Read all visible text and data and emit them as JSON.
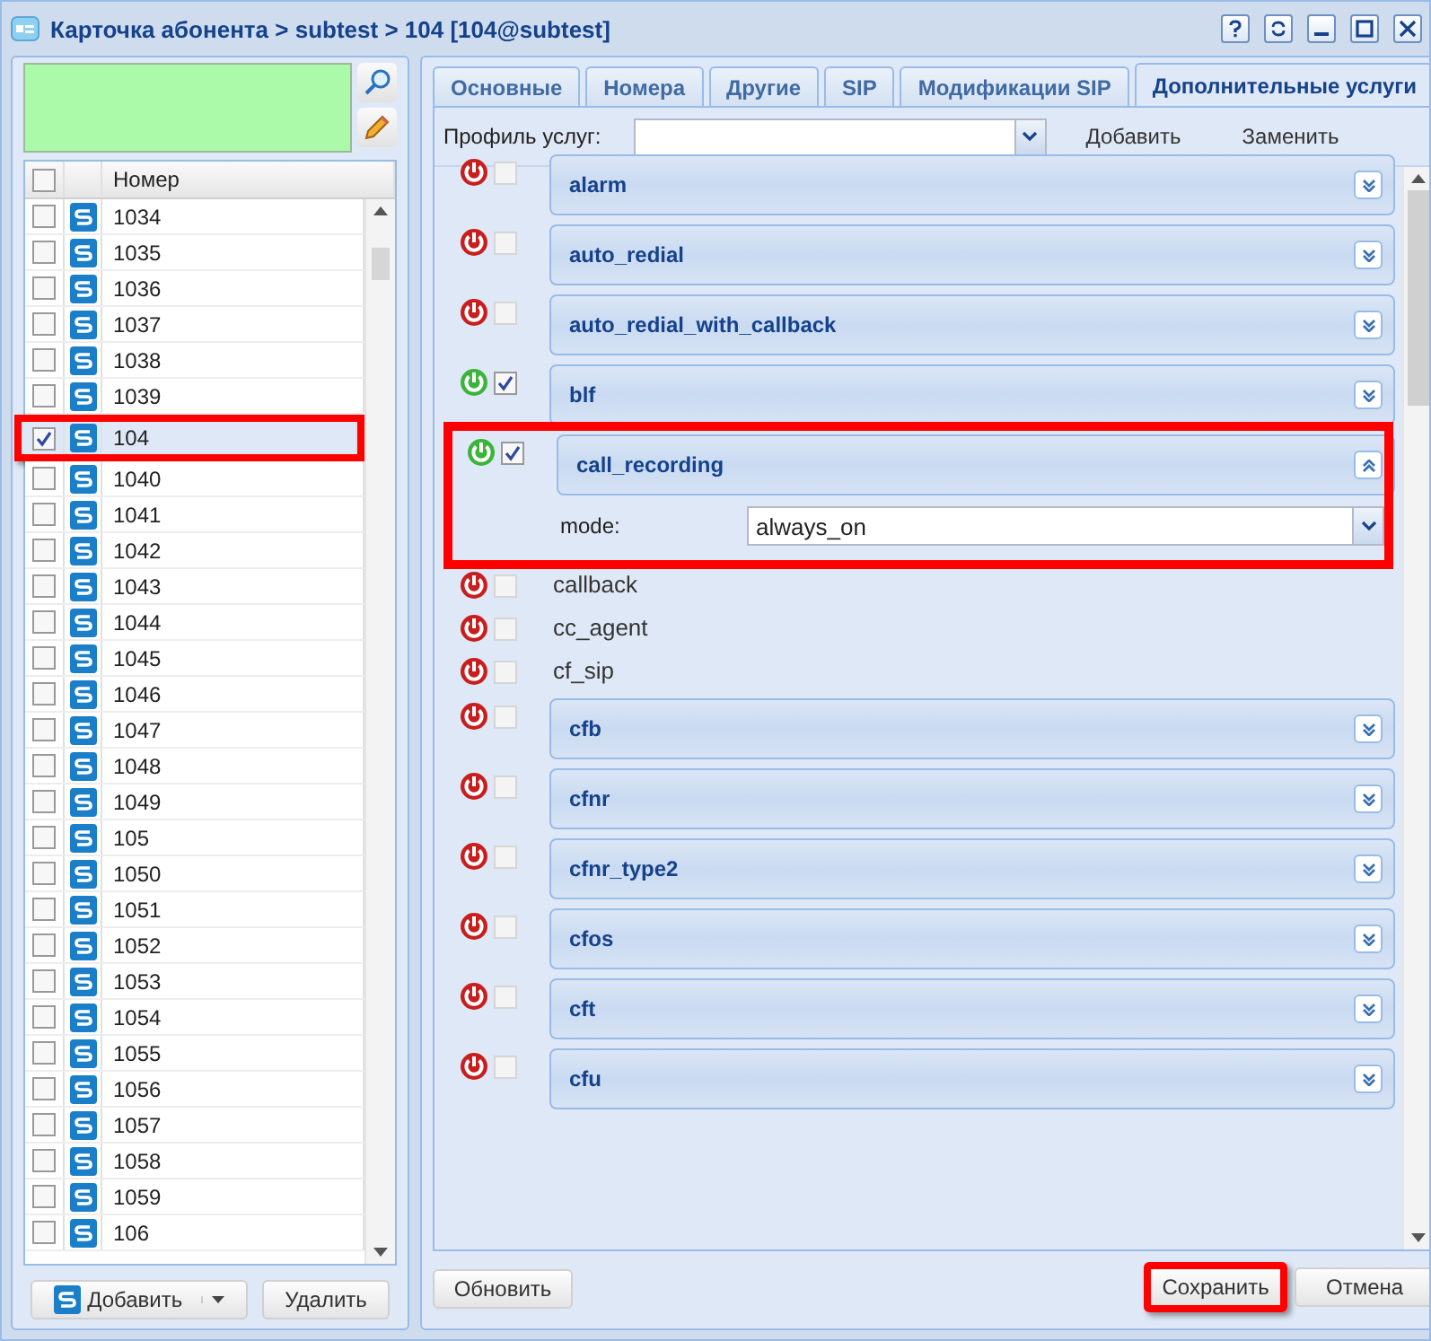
{
  "window": {
    "title": "Карточка абонента > subtest > 104 [104@subtest]"
  },
  "left_panel": {
    "grid": {
      "columns": [
        "Номер"
      ],
      "all_checked": false,
      "rows": [
        {
          "number": "1034",
          "checked": false,
          "highlighted": false
        },
        {
          "number": "1035",
          "checked": false,
          "highlighted": false
        },
        {
          "number": "1036",
          "checked": false,
          "highlighted": false
        },
        {
          "number": "1037",
          "checked": false,
          "highlighted": false
        },
        {
          "number": "1038",
          "checked": false,
          "highlighted": false
        },
        {
          "number": "1039",
          "checked": false,
          "highlighted": false
        },
        {
          "number": "104",
          "checked": true,
          "highlighted": true
        },
        {
          "number": "1040",
          "checked": false,
          "highlighted": false
        },
        {
          "number": "1041",
          "checked": false,
          "highlighted": false
        },
        {
          "number": "1042",
          "checked": false,
          "highlighted": false
        },
        {
          "number": "1043",
          "checked": false,
          "highlighted": false
        },
        {
          "number": "1044",
          "checked": false,
          "highlighted": false
        },
        {
          "number": "1045",
          "checked": false,
          "highlighted": false
        },
        {
          "number": "1046",
          "checked": false,
          "highlighted": false
        },
        {
          "number": "1047",
          "checked": false,
          "highlighted": false
        },
        {
          "number": "1048",
          "checked": false,
          "highlighted": false
        },
        {
          "number": "1049",
          "checked": false,
          "highlighted": false
        },
        {
          "number": "105",
          "checked": false,
          "highlighted": false
        },
        {
          "number": "1050",
          "checked": false,
          "highlighted": false
        },
        {
          "number": "1051",
          "checked": false,
          "highlighted": false
        },
        {
          "number": "1052",
          "checked": false,
          "highlighted": false
        },
        {
          "number": "1053",
          "checked": false,
          "highlighted": false
        },
        {
          "number": "1054",
          "checked": false,
          "highlighted": false
        },
        {
          "number": "1055",
          "checked": false,
          "highlighted": false
        },
        {
          "number": "1056",
          "checked": false,
          "highlighted": false
        },
        {
          "number": "1057",
          "checked": false,
          "highlighted": false
        },
        {
          "number": "1058",
          "checked": false,
          "highlighted": false
        },
        {
          "number": "1059",
          "checked": false,
          "highlighted": false
        },
        {
          "number": "106",
          "checked": false,
          "highlighted": false
        }
      ]
    },
    "buttons": [
      "Добавить",
      "Удалить"
    ]
  },
  "tabs": [
    {
      "label": "Основные",
      "selected": false
    },
    {
      "label": "Номера",
      "selected": false
    },
    {
      "label": "Другие",
      "selected": false
    },
    {
      "label": "SIP",
      "selected": false
    },
    {
      "label": "Модификации SIP",
      "selected": false
    },
    {
      "label": "Дополнительные услуги",
      "selected": true
    }
  ],
  "profile": {
    "label": "Профиль услуг:",
    "actions": [
      "Добавить",
      "Заменить"
    ]
  },
  "services": [
    {
      "kind": "panel",
      "name": "alarm",
      "enabled": false,
      "checked": false,
      "expanded": false,
      "highlighted": false
    },
    {
      "kind": "panel",
      "name": "auto_redial",
      "enabled": false,
      "checked": false,
      "expanded": false,
      "highlighted": false
    },
    {
      "kind": "panel",
      "name": "auto_redial_with_callback",
      "enabled": false,
      "checked": false,
      "expanded": false,
      "highlighted": false
    },
    {
      "kind": "panel",
      "name": "blf",
      "enabled": true,
      "checked": true,
      "expanded": false,
      "highlighted": false
    },
    {
      "kind": "panel",
      "name": "call_recording",
      "enabled": true,
      "checked": true,
      "expanded": true,
      "highlighted": true,
      "field": {
        "label": "mode:",
        "value": "always_on"
      }
    },
    {
      "kind": "plain",
      "name": "callback",
      "enabled": false,
      "checked": false,
      "highlighted": false
    },
    {
      "kind": "plain",
      "name": "cc_agent",
      "enabled": false,
      "checked": false,
      "highlighted": false
    },
    {
      "kind": "plain",
      "name": "cf_sip",
      "enabled": false,
      "checked": false,
      "highlighted": false
    },
    {
      "kind": "panel",
      "name": "cfb",
      "enabled": false,
      "checked": false,
      "expanded": false,
      "highlighted": false
    },
    {
      "kind": "panel",
      "name": "cfnr",
      "enabled": false,
      "checked": false,
      "expanded": false,
      "highlighted": false
    },
    {
      "kind": "panel",
      "name": "cfnr_type2",
      "enabled": false,
      "checked": false,
      "expanded": false,
      "highlighted": false
    },
    {
      "kind": "panel",
      "name": "cfos",
      "enabled": false,
      "checked": false,
      "expanded": false,
      "highlighted": false
    },
    {
      "kind": "panel",
      "name": "cft",
      "enabled": false,
      "checked": false,
      "expanded": false,
      "highlighted": false
    },
    {
      "kind": "panel",
      "name": "cfu",
      "enabled": false,
      "checked": false,
      "expanded": false,
      "highlighted": false
    }
  ],
  "footer": {
    "left": [
      {
        "label": "Обновить",
        "highlighted": false
      }
    ],
    "right": [
      {
        "label": "Сохранить",
        "highlighted": true
      },
      {
        "label": "Отмена",
        "highlighted": false
      }
    ]
  }
}
